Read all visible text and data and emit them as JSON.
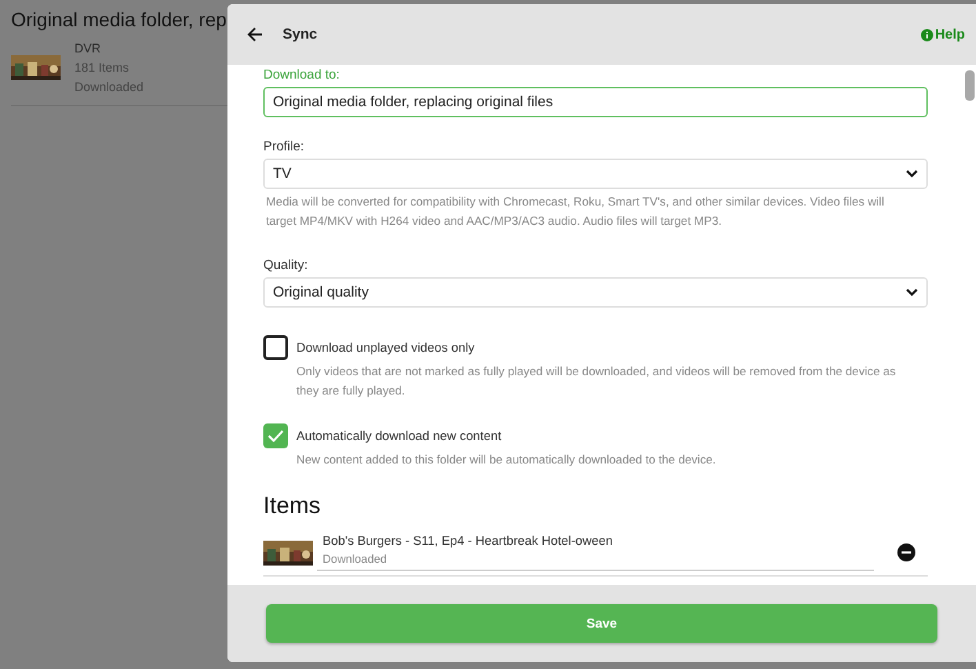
{
  "background": {
    "title": "Original media folder, rep",
    "items": [
      {
        "name": "DVR",
        "count": "181 Items",
        "status": "Downloaded"
      }
    ]
  },
  "dialog": {
    "title": "Sync",
    "help": "Help",
    "fields": [
      {
        "kind": "text",
        "label": "Download to:",
        "value": "Original media folder, replacing original files",
        "focused": true
      },
      {
        "kind": "select",
        "label": "Profile:",
        "value": "TV",
        "description": "Media will be converted for compatibility with Chromecast, Roku, Smart TV's, and other similar devices. Video files will target MP4/MKV with H264 video and AAC/MP3/AC3 audio. Audio files will target MP3.",
        "focused": false
      },
      {
        "kind": "select",
        "label": "Quality:",
        "value": "Original quality",
        "focused": false
      }
    ],
    "options": [
      {
        "label": "Download unplayed videos only",
        "description": "Only videos that are not marked as fully played will be downloaded, and videos will be removed from the device as they are fully played.",
        "checked": false
      },
      {
        "label": "Automatically download new content",
        "description": "New content added to this folder will be automatically downloaded to the device.",
        "checked": true
      }
    ],
    "items_heading": "Items",
    "items": [
      {
        "title": "Bob's Burgers - S11, Ep4 - Heartbreak Hotel-oween",
        "status": "Downloaded"
      }
    ],
    "save": "Save"
  }
}
